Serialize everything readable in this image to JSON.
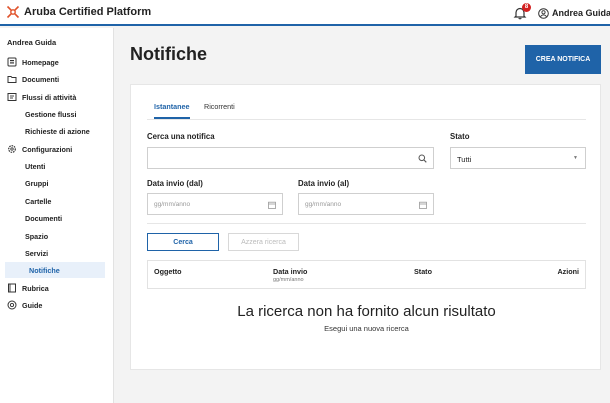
{
  "header": {
    "app_title": "Aruba Certified Platform",
    "notification_count": "8",
    "user_name": "Andrea Guida"
  },
  "sidebar": {
    "user_name": "Andrea Guida",
    "items": [
      {
        "label": "Homepage",
        "icon": "home-icon"
      },
      {
        "label": "Documenti",
        "icon": "folder-icon"
      },
      {
        "label": "Flussi di attività",
        "icon": "flow-icon"
      },
      {
        "label": "Gestione flussi"
      },
      {
        "label": "Richieste di azione"
      },
      {
        "label": "Configurazioni",
        "icon": "gear-icon"
      },
      {
        "label": "Utenti"
      },
      {
        "label": "Gruppi"
      },
      {
        "label": "Cartelle"
      },
      {
        "label": "Documenti"
      },
      {
        "label": "Spazio"
      },
      {
        "label": "Servizi"
      },
      {
        "label": "Notifiche"
      },
      {
        "label": "Rubrica",
        "icon": "book-icon"
      },
      {
        "label": "Guide",
        "icon": "help-icon"
      }
    ]
  },
  "main": {
    "page_title": "Notifiche",
    "create_button": "CREA NOTIFICA",
    "tabs": [
      {
        "label": "Istantanee"
      },
      {
        "label": "Ricorrenti"
      }
    ],
    "filters": {
      "search_label": "Cerca una notifica",
      "search_value": "",
      "status_label": "Stato",
      "status_value": "Tutti",
      "date_from_label": "Data invio (dal)",
      "date_to_label": "Data invio (al)",
      "date_placeholder": "gg/mm/anno"
    },
    "search_button": "Cerca",
    "reset_button": "Azzera ricerca",
    "table": {
      "columns": [
        "Oggetto",
        "Data invio",
        "Stato",
        "Azioni"
      ],
      "date_column_hint": "gg/mm/anno"
    },
    "empty_title": "La ricerca non ha fornito alcun risultato",
    "empty_subtitle": "Esegui una nuova ricerca"
  },
  "colors": {
    "accent": "#1f63a8",
    "badge": "#d32020",
    "logo": "#e0522a"
  }
}
